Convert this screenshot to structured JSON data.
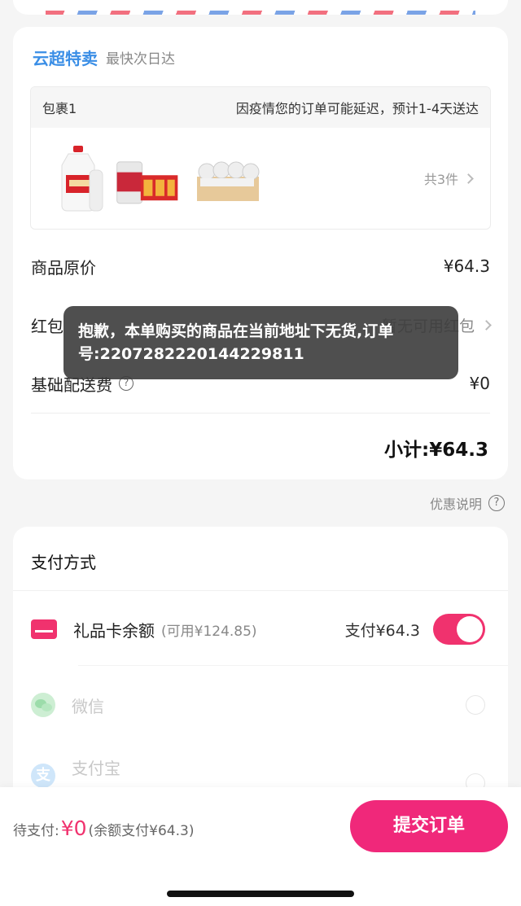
{
  "store": {
    "name": "云超特卖",
    "delivery_label": "最快次日达"
  },
  "package": {
    "name": "包裹1",
    "notice": "因疫情您的订单可能延迟，预计1-4天送达",
    "count_label": "共3件",
    "thumbnails": [
      "milk-bottle",
      "canned-congee-pack",
      "yogurt-cups-tray"
    ]
  },
  "pricing": {
    "original_label": "商品原价",
    "original_value": "¥64.3",
    "redpacket_label": "红包",
    "redpacket_value": "暂无可用红包",
    "delivery_label": "基础配送费",
    "delivery_value": "¥0",
    "subtotal": "小计:¥64.3"
  },
  "discount_note": "优惠说明",
  "payment": {
    "title": "支付方式",
    "methods": [
      {
        "name": "礼品卡余额",
        "available": "(可用¥124.85)",
        "amount": "支付¥64.3",
        "enabled": true
      },
      {
        "name": "微信",
        "selected": false
      },
      {
        "name": "支付宝",
        "selected": false
      }
    ]
  },
  "bottom": {
    "due_label": "待支付:",
    "due_amount": "¥0",
    "balance_note": "(余额支付¥64.3)",
    "submit": "提交订单"
  },
  "toast": "抱歉，本单购买的商品在当前地址下无货,订单号:22072822201442298​11",
  "colors": {
    "accent": "#f0326e",
    "store_blue": "#3a8ee6"
  }
}
